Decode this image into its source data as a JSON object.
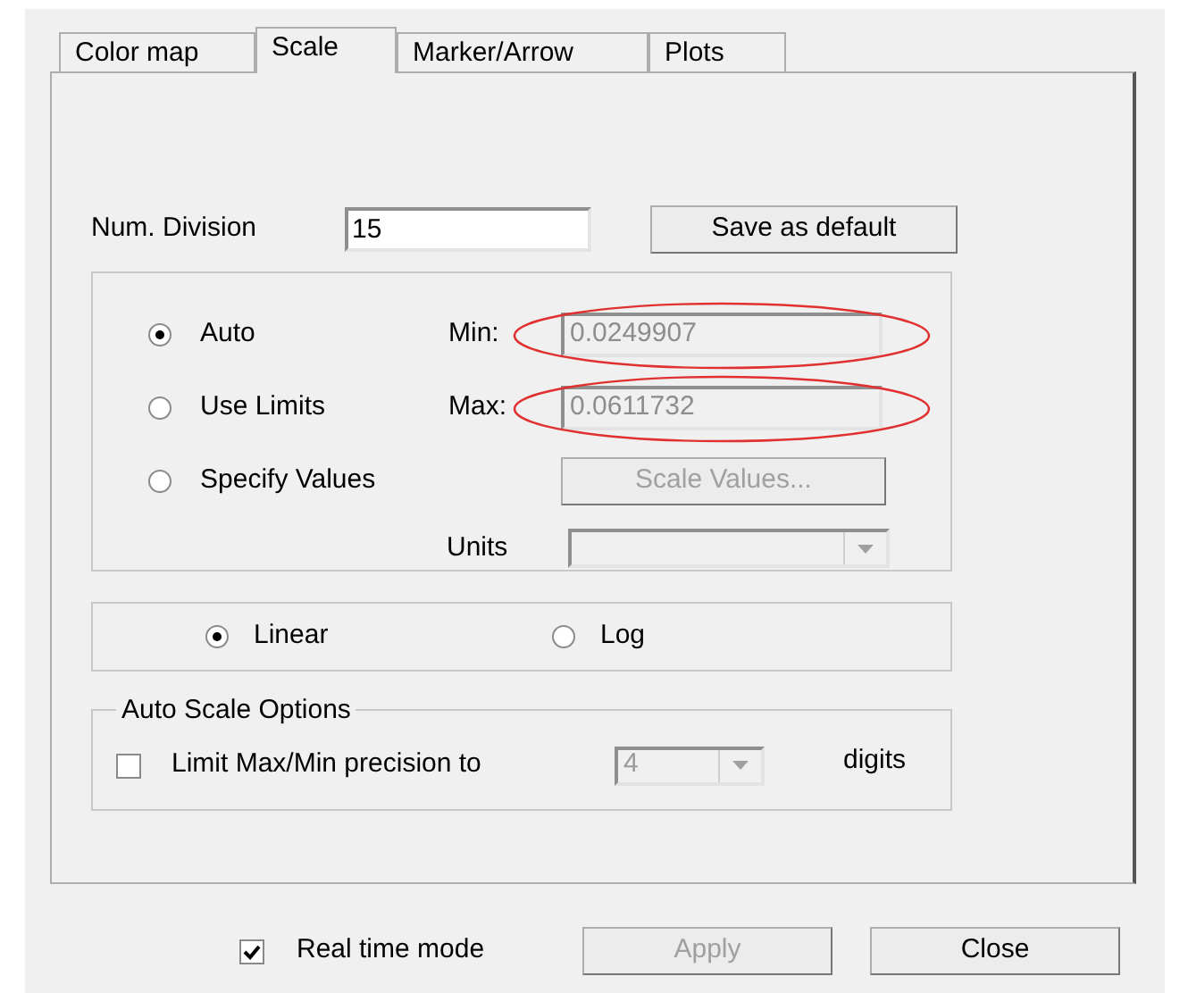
{
  "tabs": [
    {
      "label": "Color map",
      "selected": false
    },
    {
      "label": "Scale",
      "selected": true
    },
    {
      "label": "Marker/Arrow",
      "selected": false
    },
    {
      "label": "Plots",
      "selected": false
    }
  ],
  "num_division": {
    "label": "Num. Division",
    "value": "15"
  },
  "save_default_button": {
    "label": "Save as default"
  },
  "range_mode": [
    {
      "label": "Auto",
      "selected": true
    },
    {
      "label": "Use Limits",
      "selected": false
    },
    {
      "label": "Specify Values",
      "selected": false
    }
  ],
  "min": {
    "label": "Min:",
    "value": "0.0249907",
    "disabled": true,
    "highlighted": true
  },
  "max": {
    "label": "Max:",
    "value": "0.0611732",
    "disabled": true,
    "highlighted": true
  },
  "scale_values_button": {
    "label": "Scale Values...",
    "disabled": true
  },
  "units": {
    "label": "Units",
    "disabled": true
  },
  "scale_type": [
    {
      "label": "Linear",
      "selected": true
    },
    {
      "label": "Log",
      "selected": false
    }
  ],
  "auto_scale_options": {
    "title": "Auto Scale Options",
    "limit_precision": {
      "label": "Limit Max/Min precision to",
      "checked": false
    },
    "digits": {
      "value": "4",
      "disabled": true
    },
    "suffix": "digits"
  },
  "real_time_mode": {
    "label": "Real time mode",
    "checked": true
  },
  "buttons": [
    {
      "label": "Apply",
      "disabled": true
    },
    {
      "label": "Close",
      "disabled": false
    }
  ]
}
